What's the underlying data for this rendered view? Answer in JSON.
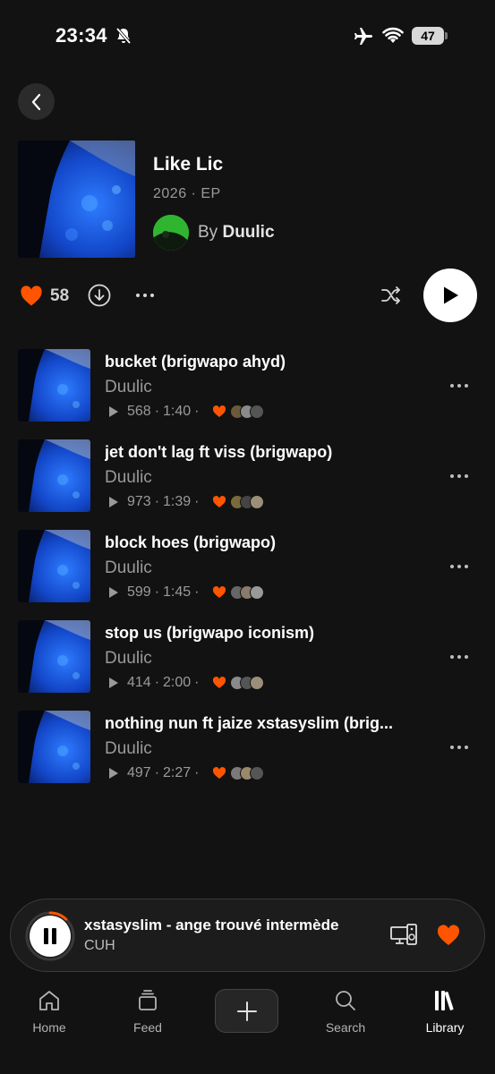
{
  "status_bar": {
    "time": "23:34",
    "battery": "47"
  },
  "album": {
    "title": "Like Lic",
    "year": "2026",
    "type": "EP",
    "by_label": "By",
    "artist": "Duulic",
    "likes": "58"
  },
  "tracks": [
    {
      "title": "bucket (brigwapo ahyd)",
      "artist": "Duulic",
      "plays": "568",
      "duration": "1:40"
    },
    {
      "title": "jet don't lag ft viss (brigwapo)",
      "artist": "Duulic",
      "plays": "973",
      "duration": "1:39"
    },
    {
      "title": "block hoes (brigwapo)",
      "artist": "Duulic",
      "plays": "599",
      "duration": "1:45"
    },
    {
      "title": "stop us (brigwapo iconism)",
      "artist": "Duulic",
      "plays": "414",
      "duration": "2:00"
    },
    {
      "title": "nothing nun ft jaize xstasyslim (brig...",
      "artist": "Duulic",
      "plays": "497",
      "duration": "2:27"
    }
  ],
  "now_playing": {
    "artist": "xstasyslim",
    "separator": "-",
    "title": "ange trouvé intermède",
    "subtitle": "CUH",
    "progress": 0.12
  },
  "tab_bar": {
    "tabs": [
      {
        "label": "Home",
        "icon": "home-icon"
      },
      {
        "label": "Feed",
        "icon": "feed-icon"
      },
      {
        "label": "Search",
        "icon": "search-icon"
      },
      {
        "label": "Library",
        "icon": "library-icon",
        "active": true
      }
    ]
  },
  "colors": {
    "background": "#121212",
    "accent": "#ff5500",
    "text_secondary": "#9a9a9a"
  }
}
